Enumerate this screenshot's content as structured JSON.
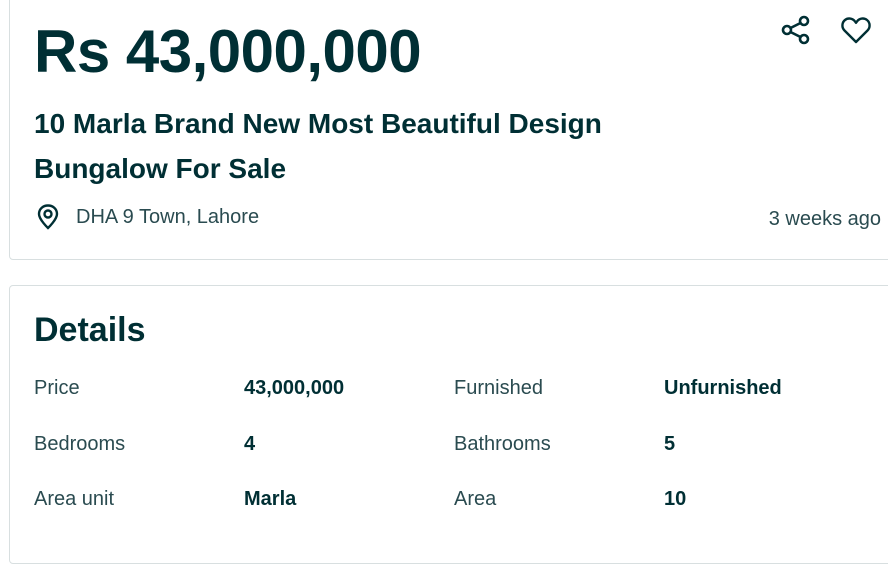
{
  "listing": {
    "price": "Rs 43,000,000",
    "title": "10 Marla Brand New Most Beautiful Design Bungalow For Sale",
    "location": "DHA 9 Town, Lahore",
    "posted": "3 weeks ago",
    "icons": {
      "share": "share-icon",
      "favorite": "heart-icon",
      "location": "location-pin-icon"
    }
  },
  "details": {
    "heading": "Details",
    "rows": [
      [
        {
          "label": "Price",
          "value": "43,000,000"
        },
        {
          "label": "Furnished",
          "value": "Unfurnished"
        }
      ],
      [
        {
          "label": "Bedrooms",
          "value": "4"
        },
        {
          "label": "Bathrooms",
          "value": "5"
        }
      ],
      [
        {
          "label": "Area unit",
          "value": "Marla"
        },
        {
          "label": "Area",
          "value": "10"
        }
      ]
    ]
  },
  "colors": {
    "text_primary": "#002f34",
    "text_secondary": "#2a4b50",
    "border": "#d8dfe0"
  }
}
